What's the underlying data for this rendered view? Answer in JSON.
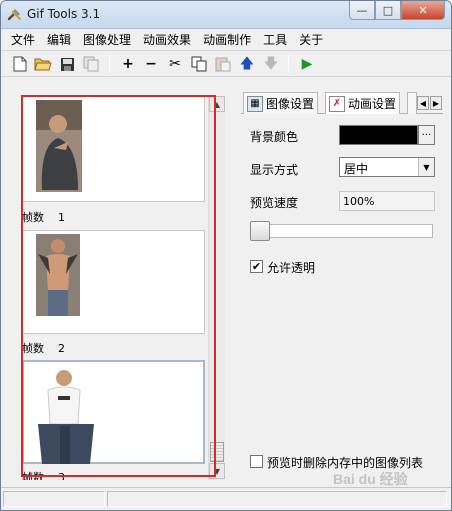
{
  "window": {
    "title": "Gif Tools 3.1",
    "min_label": "—",
    "max_label": "□",
    "close_label": "✕"
  },
  "menu": [
    "文件",
    "编辑",
    "图像处理",
    "动画效果",
    "动画制作",
    "工具",
    "关于"
  ],
  "toolbar": {
    "icons": [
      "new-file-icon",
      "open-folder-icon",
      "save-icon",
      "copy-pages-icon",
      "add-icon",
      "remove-icon",
      "cut-icon",
      "copy-icon",
      "paste-icon",
      "move-up-icon",
      "move-down-icon",
      "play-icon"
    ],
    "add_glyph": "+",
    "remove_glyph": "−",
    "cut_glyph": "✂",
    "up_glyph": "🡅",
    "down_glyph": "🡇",
    "play_glyph": "▶"
  },
  "frames": {
    "label": "帧数",
    "items": [
      {
        "number": "1"
      },
      {
        "number": "2"
      },
      {
        "number": "3"
      }
    ]
  },
  "tabs": [
    {
      "label": "图像设置",
      "icon": "image-settings-icon"
    },
    {
      "label": "动画设置",
      "icon": "animation-settings-icon"
    }
  ],
  "settings": {
    "bg_color_label": "背景颜色",
    "bg_color": "#000000",
    "color_button": "···",
    "display_mode_label": "显示方式",
    "display_mode_value": "居中",
    "preview_speed_label": "预览速度",
    "preview_speed_value": "100%",
    "allow_transparency_label": "允许透明",
    "allow_transparency_checked": "✔",
    "delete_cache_label": "预览时删除内存中的图像列表"
  },
  "watermark": "Bai du 经验"
}
